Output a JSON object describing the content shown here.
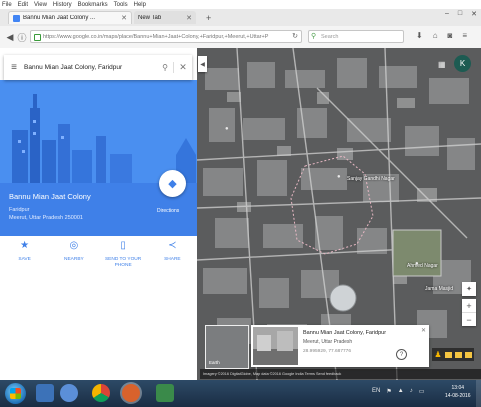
{
  "browser": {
    "menu": [
      "File",
      "Edit",
      "View",
      "History",
      "Bookmarks",
      "Tools",
      "Help"
    ],
    "tabs": [
      {
        "title": "Bannu Mian Jaat Colony ...",
        "active": true
      },
      {
        "title": "New Tab",
        "active": false
      }
    ],
    "new_tab_symbol": "+",
    "url": "https://www.google.co.in/maps/place/Bannu+Mian+Jaat+Colony,+Faridpur,+Meerut,+Uttar+P",
    "search_placeholder": "Search"
  },
  "maps": {
    "search_query": "Bannu Mian Jaat Colony, Faridpur",
    "place": {
      "name": "Bannu Mian Jaat Colony",
      "line1": "Faridpur",
      "line2": "Meerut, Uttar Pradesh 250001"
    },
    "directions_label": "Directions",
    "actions": [
      {
        "label": "SAVE",
        "icon": "star-icon"
      },
      {
        "label": "NEARBY",
        "icon": "nearby-icon"
      },
      {
        "label": "SEND TO YOUR PHONE",
        "icon": "phone-icon"
      },
      {
        "label": "SHARE",
        "icon": "share-icon"
      }
    ],
    "avatar_letter": "K",
    "map_labels": [
      "Sanjay Gandhi Nagar",
      "Ahmed Nagar",
      "Jama Masjid"
    ],
    "earth_label": "Earth",
    "street_view": {
      "title": "Bannu Mian Jaat Colony, Faridpur",
      "subtitle": "Meerut, Uttar Pradesh",
      "coords": "28.995929, 77.687776"
    },
    "footer": "Imagery ©2016 DigitalGlobe, Map data ©2016 Google  India  Terms  Send feedback"
  },
  "taskbar": {
    "language": "EN",
    "time": "13:04",
    "date": "14-08-2016"
  },
  "colors": {
    "maps_blue": "#3f80e8",
    "map_satellite": "#58595a"
  }
}
